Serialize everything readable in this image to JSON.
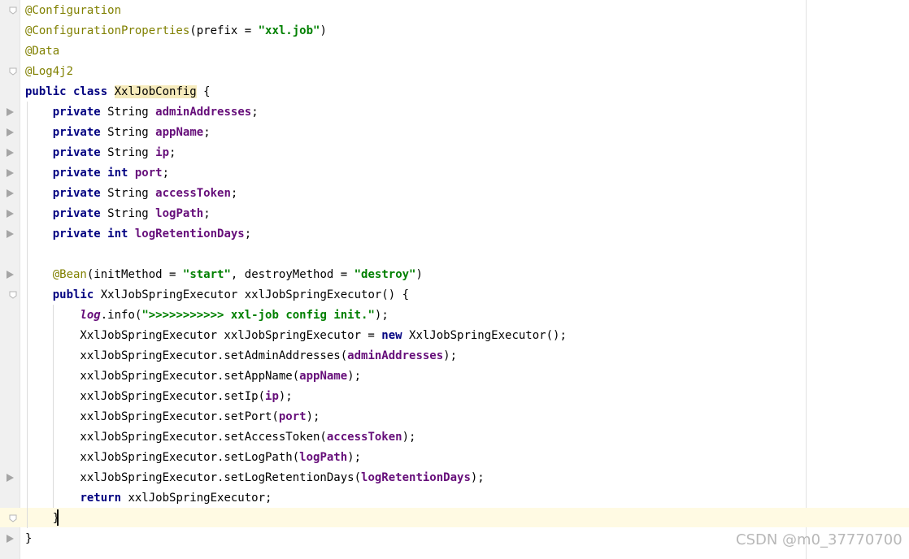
{
  "editor": {
    "lines": [
      [
        {
          "t": "@Configuration",
          "c": "ann"
        }
      ],
      [
        {
          "t": "@ConfigurationProperties",
          "c": "ann"
        },
        {
          "t": "(prefix = "
        },
        {
          "t": "\"xxl.job\"",
          "c": "str"
        },
        {
          "t": ")"
        }
      ],
      [
        {
          "t": "@Data",
          "c": "ann"
        }
      ],
      [
        {
          "t": "@Log4j2",
          "c": "ann"
        }
      ],
      [
        {
          "t": "public class",
          "c": "kw"
        },
        {
          "t": " "
        },
        {
          "t": "XxlJobConfig",
          "c": "hl"
        },
        {
          "t": " {"
        }
      ],
      [
        {
          "t": "    "
        },
        {
          "t": "private",
          "c": "kw"
        },
        {
          "t": " String "
        },
        {
          "t": "adminAddresses",
          "c": "field"
        },
        {
          "t": ";"
        }
      ],
      [
        {
          "t": "    "
        },
        {
          "t": "private",
          "c": "kw"
        },
        {
          "t": " String "
        },
        {
          "t": "appName",
          "c": "field"
        },
        {
          "t": ";"
        }
      ],
      [
        {
          "t": "    "
        },
        {
          "t": "private",
          "c": "kw"
        },
        {
          "t": " String "
        },
        {
          "t": "ip",
          "c": "field"
        },
        {
          "t": ";"
        }
      ],
      [
        {
          "t": "    "
        },
        {
          "t": "private int",
          "c": "kw"
        },
        {
          "t": " "
        },
        {
          "t": "port",
          "c": "field"
        },
        {
          "t": ";"
        }
      ],
      [
        {
          "t": "    "
        },
        {
          "t": "private",
          "c": "kw"
        },
        {
          "t": " String "
        },
        {
          "t": "accessToken",
          "c": "field"
        },
        {
          "t": ";"
        }
      ],
      [
        {
          "t": "    "
        },
        {
          "t": "private",
          "c": "kw"
        },
        {
          "t": " String "
        },
        {
          "t": "logPath",
          "c": "field"
        },
        {
          "t": ";"
        }
      ],
      [
        {
          "t": "    "
        },
        {
          "t": "private int",
          "c": "kw"
        },
        {
          "t": " "
        },
        {
          "t": "logRetentionDays",
          "c": "field"
        },
        {
          "t": ";"
        }
      ],
      [],
      [
        {
          "t": "    "
        },
        {
          "t": "@Bean",
          "c": "ann"
        },
        {
          "t": "(initMethod = "
        },
        {
          "t": "\"start\"",
          "c": "str"
        },
        {
          "t": ", destroyMethod = "
        },
        {
          "t": "\"destroy\"",
          "c": "str"
        },
        {
          "t": ")"
        }
      ],
      [
        {
          "t": "    "
        },
        {
          "t": "public",
          "c": "kw"
        },
        {
          "t": " XxlJobSpringExecutor xxlJobSpringExecutor() {"
        }
      ],
      [
        {
          "t": "        "
        },
        {
          "t": "log",
          "c": "static"
        },
        {
          "t": ".info("
        },
        {
          "t": "\">>>>>>>>>>> xxl-job config init.\"",
          "c": "str"
        },
        {
          "t": ");"
        }
      ],
      [
        {
          "t": "        XxlJobSpringExecutor xxlJobSpringExecutor = "
        },
        {
          "t": "new",
          "c": "kw"
        },
        {
          "t": " XxlJobSpringExecutor();"
        }
      ],
      [
        {
          "t": "        xxlJobSpringExecutor.setAdminAddresses("
        },
        {
          "t": "adminAddresses",
          "c": "field"
        },
        {
          "t": ");"
        }
      ],
      [
        {
          "t": "        xxlJobSpringExecutor.setAppName("
        },
        {
          "t": "appName",
          "c": "field"
        },
        {
          "t": ");"
        }
      ],
      [
        {
          "t": "        xxlJobSpringExecutor.setIp("
        },
        {
          "t": "ip",
          "c": "field"
        },
        {
          "t": ");"
        }
      ],
      [
        {
          "t": "        xxlJobSpringExecutor.setPort("
        },
        {
          "t": "port",
          "c": "field"
        },
        {
          "t": ");"
        }
      ],
      [
        {
          "t": "        xxlJobSpringExecutor.setAccessToken("
        },
        {
          "t": "accessToken",
          "c": "field"
        },
        {
          "t": ");"
        }
      ],
      [
        {
          "t": "        xxlJobSpringExecutor.setLogPath("
        },
        {
          "t": "logPath",
          "c": "field"
        },
        {
          "t": ");"
        }
      ],
      [
        {
          "t": "        xxlJobSpringExecutor.setLogRetentionDays("
        },
        {
          "t": "logRetentionDays",
          "c": "field"
        },
        {
          "t": ");"
        }
      ],
      [
        {
          "t": "        "
        },
        {
          "t": "return",
          "c": "kw"
        },
        {
          "t": " xxlJobSpringExecutor;"
        }
      ],
      [
        {
          "t": "    }"
        }
      ],
      [
        {
          "t": "}"
        }
      ]
    ],
    "fold_marker_lines": [
      0,
      3,
      14,
      25
    ],
    "gutter_marker_lines": [
      5,
      6,
      7,
      8,
      9,
      10,
      11,
      13,
      23,
      26
    ],
    "current_line": 25
  },
  "watermark": "CSDN @m0_37770700"
}
